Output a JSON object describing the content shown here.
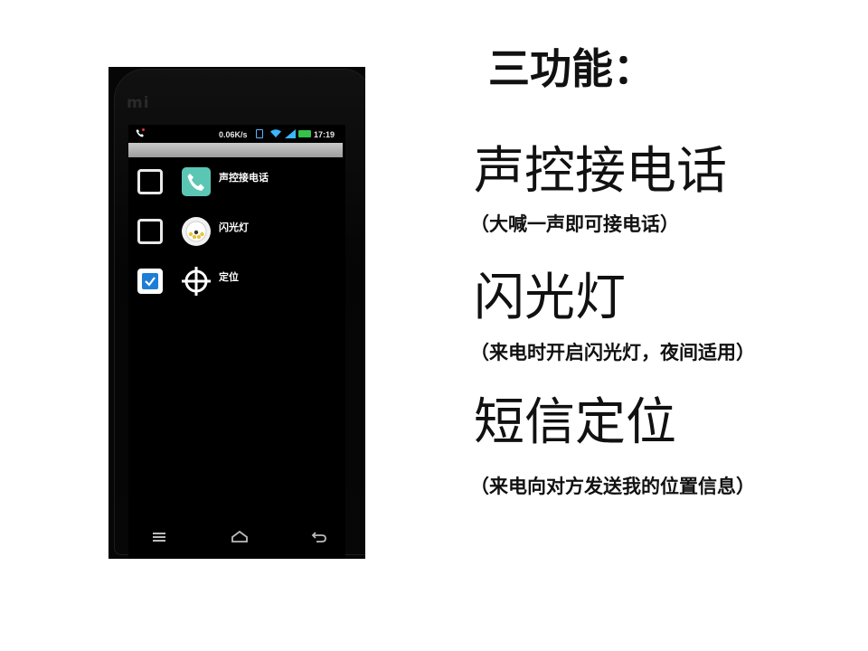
{
  "slide": {
    "heading": "三功能：",
    "features": [
      {
        "title": "声控接电话",
        "description": "（大喊一声即可接电话）"
      },
      {
        "title": "闪光灯",
        "description": "（来电时开启闪光灯，夜间适用）"
      },
      {
        "title": "短信定位",
        "description": "（来电向对方发送我的位置信息）"
      }
    ]
  },
  "phone": {
    "brand": "mi",
    "status_bar": {
      "network_speed": "0.06K/s",
      "time": "17:19"
    },
    "app_title": "",
    "settings": [
      {
        "title": "声控接电话",
        "subtitle": "",
        "checked": false,
        "icon": "phone-handset-icon"
      },
      {
        "title": "闪光灯",
        "subtitle": "",
        "checked": false,
        "icon": "flashlight-icon"
      },
      {
        "title": "定位",
        "subtitle": "",
        "checked": true,
        "icon": "crosshair-icon"
      }
    ],
    "nav_icons": [
      "menu-icon",
      "home-icon",
      "back-icon"
    ]
  },
  "colors": {
    "checkbox_checked": "#1e7ed6",
    "phone_icon_bg": "#5cc6b4",
    "battery": "#35c24a"
  }
}
